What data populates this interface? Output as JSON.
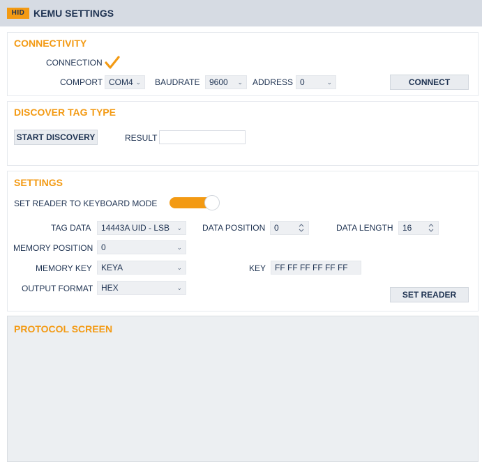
{
  "header": {
    "logo_text": "HID",
    "title": "KEMU SETTINGS"
  },
  "connectivity": {
    "title": "CONNECTIVITY",
    "connection_label": "CONNECTION",
    "connection_checked": true,
    "comport_label": "COMPORT",
    "comport_value": "COM4",
    "baudrate_label": "BAUDRATE",
    "baudrate_value": "9600",
    "address_label": "ADDRESS",
    "address_value": "0",
    "connect_button": "CONNECT"
  },
  "discover": {
    "title": "DISCOVER TAG TYPE",
    "start_button": "START DISCOVERY",
    "result_label": "RESULT",
    "result_value": ""
  },
  "settings": {
    "title": "SETTINGS",
    "keyboard_mode_label": "SET READER TO KEYBOARD MODE",
    "keyboard_mode_on": true,
    "tag_data_label": "TAG DATA",
    "tag_data_value": "14443A UID - LSB",
    "data_position_label": "DATA POSITION",
    "data_position_value": "0",
    "data_length_label": "DATA LENGTH",
    "data_length_value": "16",
    "memory_position_label": "MEMORY POSITION",
    "memory_position_value": "0",
    "memory_key_label": "MEMORY KEY",
    "memory_key_value": "KEYA",
    "key_label": "KEY",
    "key_value": "FF FF FF FF FF FF",
    "output_format_label": "OUTPUT FORMAT",
    "output_format_value": "HEX",
    "set_reader_button": "SET READER"
  },
  "protocol": {
    "title": "PROTOCOL SCREEN"
  },
  "colors": {
    "accent": "#f39a13",
    "text": "#1f3352",
    "header_bg": "#d6dbe3",
    "field_bg": "#eef0f3"
  }
}
